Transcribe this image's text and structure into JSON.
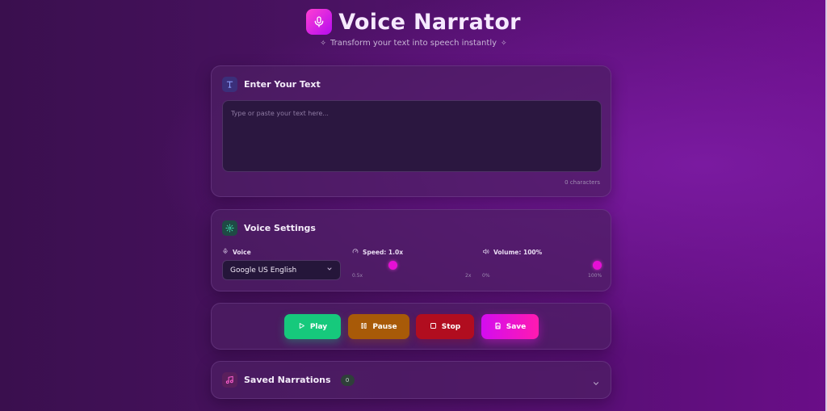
{
  "app": {
    "title": "Voice Narrator",
    "subtitle": "Transform your text into speech instantly"
  },
  "text_card": {
    "title": "Enter Your Text",
    "placeholder": "Type or paste your text here...",
    "char_count": "0 characters"
  },
  "settings": {
    "title": "Voice Settings",
    "voice_label": "Voice",
    "voice_selected": "Google US English",
    "speed_label": "Speed: 1.0x",
    "speed_min": "0.5x",
    "speed_max": "2x",
    "speed_value": 1.0,
    "volume_label": "Volume: 100%",
    "volume_min": "0%",
    "volume_max": "100%",
    "volume_value": 100
  },
  "controls": {
    "play": "Play",
    "pause": "Pause",
    "stop": "Stop",
    "save": "Save"
  },
  "saved": {
    "title": "Saved Narrations",
    "count": "0"
  },
  "colors": {
    "accent": "#e60fd5",
    "play": "#16c97c",
    "pause": "#a85a08",
    "stop": "#b10d1f",
    "save": "#d30cf0"
  },
  "icons": {
    "logo": "microphone-icon",
    "text": "type-icon",
    "settings": "gear-icon",
    "voice": "mic-small-icon",
    "speed": "gauge-icon",
    "volume": "volume-icon",
    "play": "play-icon",
    "pause": "pause-icon",
    "stop": "stop-icon",
    "save": "save-icon",
    "saved": "music-note-icon",
    "expand": "chevron-down-icon"
  }
}
